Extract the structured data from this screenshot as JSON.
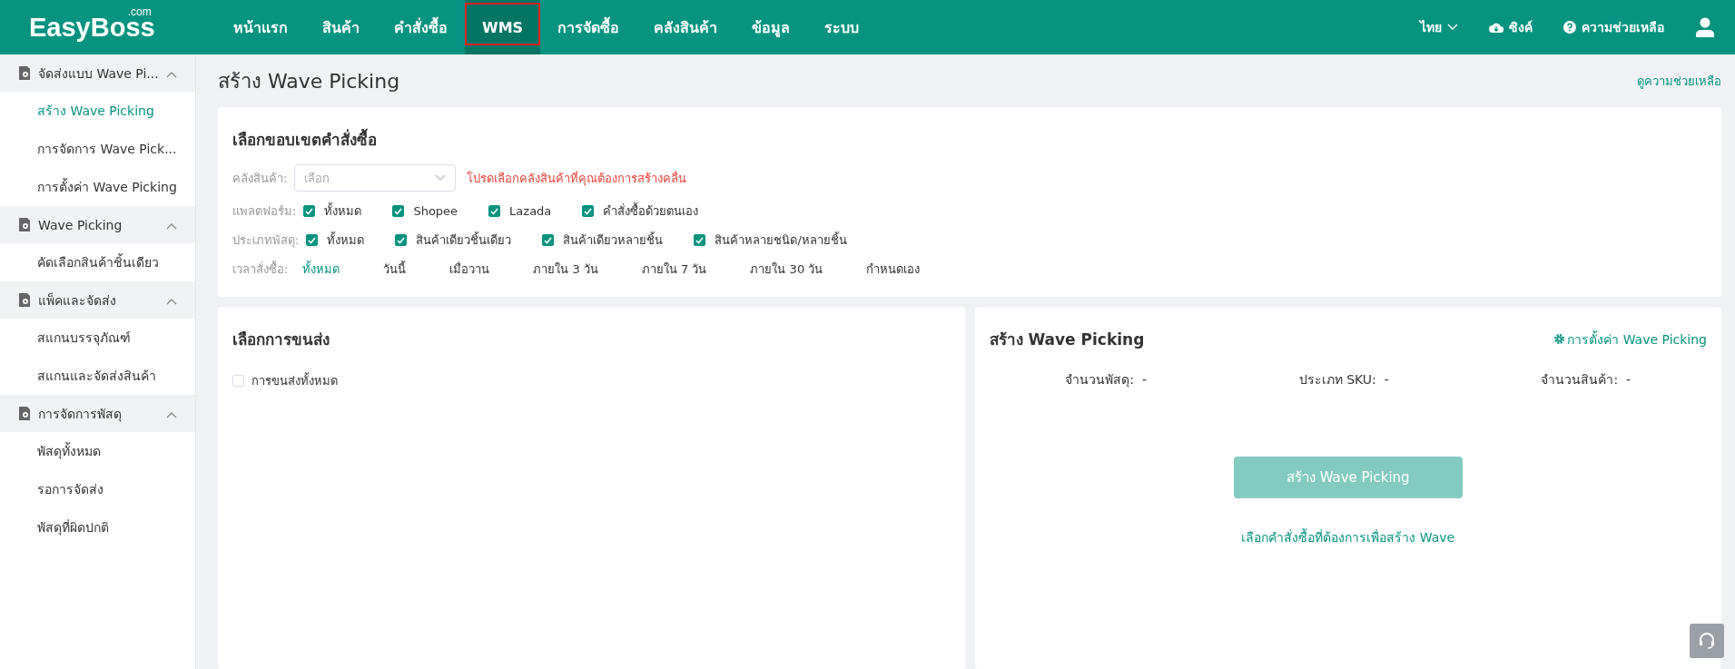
{
  "header": {
    "logo": "EasyBoss",
    "logo_suffix": ".com",
    "nav": [
      {
        "label": "หน้าแรก",
        "selected": false
      },
      {
        "label": "สินค้า",
        "selected": false
      },
      {
        "label": "คำสั่งซื้อ",
        "selected": false
      },
      {
        "label": "WMS",
        "selected": true
      },
      {
        "label": "การจัดซื้อ",
        "selected": false
      },
      {
        "label": "คลังสินค้า",
        "selected": false
      },
      {
        "label": "ข้อมูล",
        "selected": false
      },
      {
        "label": "ระบบ",
        "selected": false
      }
    ],
    "language": "ไทย",
    "sync": "ซิงค์",
    "help": "ความช่วยเหลือ"
  },
  "sidebar": {
    "groups": [
      {
        "label": "จัดส่งแบบ Wave Pi...",
        "expanded": true,
        "items": [
          {
            "label": "สร้าง Wave Picking",
            "selected": true
          },
          {
            "label": "การจัดการ Wave Pick...",
            "selected": false
          },
          {
            "label": "การตั้งค่า Wave Picking",
            "selected": false
          }
        ]
      },
      {
        "label": "Wave Picking",
        "expanded": true,
        "items": [
          {
            "label": "คัดเลือกสินค้าชิ้นเดียว",
            "selected": false
          }
        ]
      },
      {
        "label": "แพ็คและจัดส่ง",
        "expanded": true,
        "items": [
          {
            "label": "สแกนบรรจุภัณฑ์",
            "selected": false
          },
          {
            "label": "สแกนและจัดส่งสินค้า",
            "selected": false
          }
        ]
      },
      {
        "label": "การจัดการพัสดุ",
        "expanded": true,
        "items": [
          {
            "label": "พัสดุทั้งหมด",
            "selected": false
          },
          {
            "label": "รอการจัดส่ง",
            "selected": false
          },
          {
            "label": "พัสดุที่ผิดปกติ",
            "selected": false
          }
        ]
      }
    ]
  },
  "page": {
    "title": "สร้าง Wave Picking",
    "help_link": "ดูความช่วยเหลือ"
  },
  "filter": {
    "title": "เลือกขอบเขตคำสั่งซื้อ",
    "warehouse": {
      "label": "คลังสินค้า:",
      "placeholder": "เลือก",
      "warning": "โปรดเลือกคลังสินค้าที่คุณต้องการสร้างคลื่น"
    },
    "platform": {
      "label": "แพลตฟอร์ม:",
      "options": [
        {
          "label": "ทั้งหมด",
          "checked": true
        },
        {
          "label": "Shopee",
          "checked": true
        },
        {
          "label": "Lazada",
          "checked": true
        },
        {
          "label": "คำสั่งซื้อด้วยตนเอง",
          "checked": true
        }
      ]
    },
    "parcel_type": {
      "label": "ประเภทพัสดุ:",
      "options": [
        {
          "label": "ทั้งหมด",
          "checked": true
        },
        {
          "label": "สินค้าเดียวชิ้นเดียว",
          "checked": true
        },
        {
          "label": "สินค้าเดียวหลายชิ้น",
          "checked": true
        },
        {
          "label": "สินค้าหลายชนิด/หลายชิ้น",
          "checked": true
        }
      ]
    },
    "order_time": {
      "label": "เวลาสั่งซื้อ:",
      "options": [
        {
          "label": "ทั้งหมด",
          "selected": true
        },
        {
          "label": "วันนี้",
          "selected": false
        },
        {
          "label": "เมื่อวาน",
          "selected": false
        },
        {
          "label": "ภายใน 3 วัน",
          "selected": false
        },
        {
          "label": "ภายใน 7 วัน",
          "selected": false
        },
        {
          "label": "ภายใน 30 วัน",
          "selected": false
        },
        {
          "label": "กำหนดเอง",
          "selected": false
        }
      ]
    }
  },
  "shipping": {
    "title": "เลือกการขนส่ง",
    "all": {
      "label": "การขนส่งทั้งหมด",
      "checked": false
    }
  },
  "create": {
    "title": "สร้าง Wave Picking",
    "settings_link": "การตั้งค่า Wave Picking",
    "stats": [
      {
        "label": "จำนวนพัสดุ:",
        "value": "-"
      },
      {
        "label": "ประเภท SKU:",
        "value": "-"
      },
      {
        "label": "จำนวนสินค้า:",
        "value": "-"
      }
    ],
    "button": {
      "label": "สร้าง Wave Picking",
      "disabled": true
    },
    "hint": "เลือกคำสั่งซื้อที่ต้องการเพื่อสร้าง Wave"
  }
}
